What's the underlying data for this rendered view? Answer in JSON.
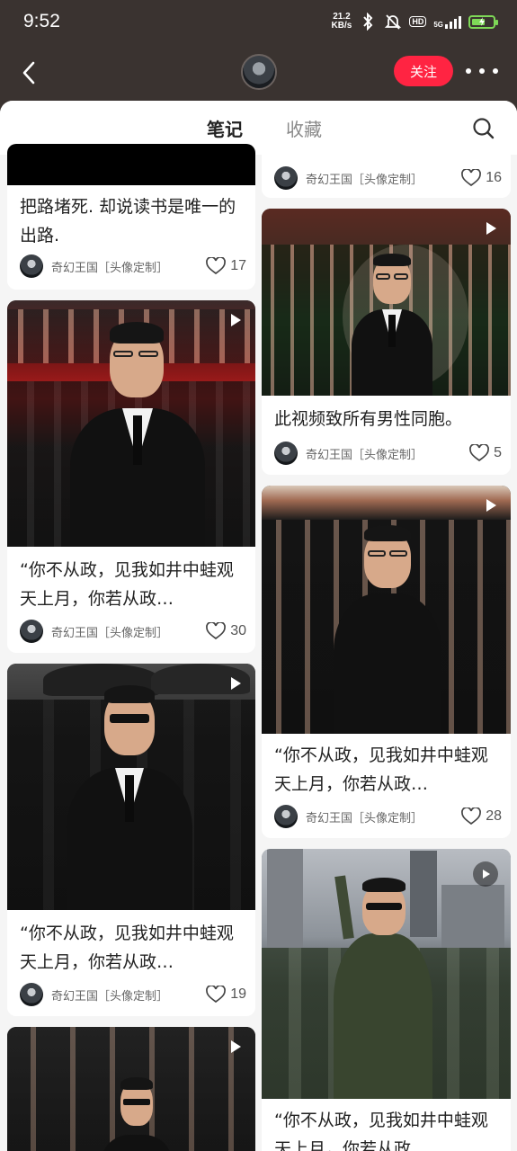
{
  "status_bar": {
    "time": "9:52",
    "net_speed_value": "21.2",
    "net_speed_unit": "KB/s",
    "hd_label": "HD",
    "signal_label": "5G",
    "battery_level": 0.6,
    "icons": [
      "bluetooth-icon",
      "mute-bell-icon",
      "hd-icon",
      "signal-icon",
      "battery-charging-icon"
    ]
  },
  "header": {
    "follow_label": "关注",
    "icons": [
      "back-arrow-icon",
      "profile-avatar",
      "more-icon"
    ]
  },
  "tabs": {
    "notes": "笔记",
    "collections": "收藏",
    "active": "notes"
  },
  "author": {
    "name": "奇幻王国［头像定制］"
  },
  "left_column": [
    {
      "title": "把路堵死. 却说读书是唯一的出路.",
      "likes": "17",
      "video": false
    },
    {
      "title": "“你不从政，见我如井中蛙观天上月，你若从政…",
      "likes": "30",
      "video": true
    },
    {
      "title": "“你不从政，见我如井中蛙观天上月，你若从政…",
      "likes": "19",
      "video": true
    },
    {
      "title": "",
      "likes": "",
      "video": true
    }
  ],
  "right_column": [
    {
      "title": "",
      "likes": "16",
      "video": false
    },
    {
      "title": "此视频致所有男性同胞。",
      "likes": "5",
      "video": true
    },
    {
      "title": "“你不从政，见我如井中蛙观天上月，你若从政…",
      "likes": "28",
      "video": true
    },
    {
      "title": "“你不从政，见我如井中蛙观天上月，你若从政…",
      "likes": "",
      "video": true
    }
  ],
  "colors": {
    "brand_red": "#ff2442",
    "header_bg": "#3a3330",
    "battery_green": "#7ed957"
  }
}
